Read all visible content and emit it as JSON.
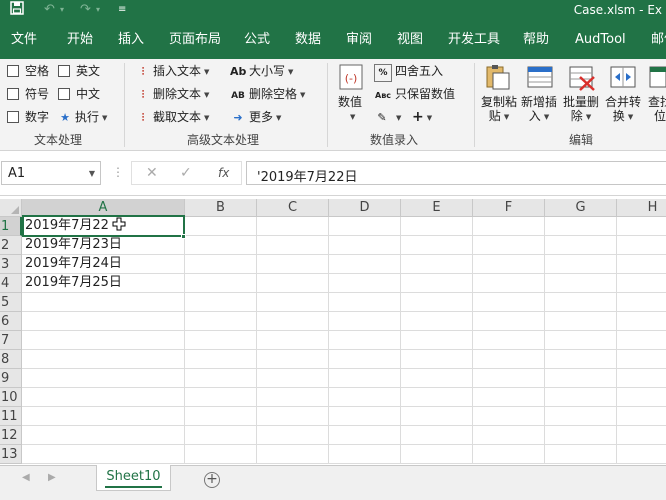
{
  "title_bar": {
    "doc_title": "Case.xlsm - Ex",
    "bg": "#217346"
  },
  "menu_tabs": [
    "文件",
    "开始",
    "插入",
    "页面布局",
    "公式",
    "数据",
    "审阅",
    "视图",
    "开发工具",
    "帮助",
    "AudTool",
    "邮件"
  ],
  "ribbon": {
    "text_process": {
      "checkboxes": [
        "空格",
        "英文",
        "符号",
        "中文",
        "数字"
      ],
      "exec_label": "执行",
      "group_label": "文本处理"
    },
    "advanced_text": {
      "insert_text": "插入文本",
      "delete_text": "删除文本",
      "extract_text": "截取文本",
      "case_label": "大小写",
      "delete_space": "删除空格",
      "more_label": "更多",
      "group_label": "高级文本处理"
    },
    "value_entry": {
      "value_label": "数值",
      "round_label": "四舍五入",
      "keep_value": "只保留数值",
      "group_label": "数值录入"
    },
    "edit": {
      "copy_paste": [
        "复制粘",
        "贴"
      ],
      "add_insert": [
        "新增插",
        "入"
      ],
      "batch_delete": [
        "批量删",
        "除"
      ],
      "merge_convert": [
        "合并转",
        "换"
      ],
      "lookup": [
        "查找",
        "位"
      ],
      "group_label": "编辑"
    }
  },
  "formula_bar": {
    "name_box": "A1",
    "formula": "'2019年7月22日",
    "fx": "fx"
  },
  "sheet": {
    "columns": [
      "A",
      "B",
      "C",
      "D",
      "E",
      "F",
      "G",
      "H"
    ],
    "rows": [
      "1",
      "2",
      "3",
      "4",
      "5",
      "6",
      "7",
      "8",
      "9",
      "10",
      "11",
      "12",
      "13"
    ],
    "col_a_values": [
      "2019年7月22",
      "2019年7月23日",
      "2019年7月24日",
      "2019年7月25日"
    ],
    "accent": "#217346"
  },
  "sheet_tabs": {
    "active": "Sheet10"
  }
}
